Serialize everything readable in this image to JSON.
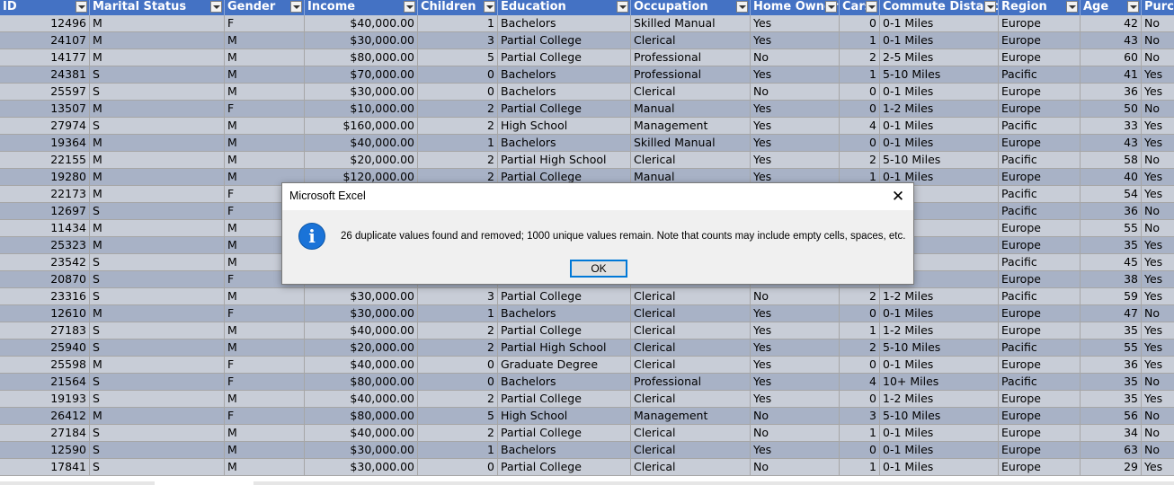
{
  "spreadsheet": {
    "headers": [
      "ID",
      "Marital Status",
      "Gender",
      "Income",
      "Children",
      "Education",
      "Occupation",
      "Home Owner",
      "Cars",
      "Commute Distance",
      "Region",
      "Age",
      "Purchased Bike"
    ],
    "rows": [
      [
        "12496",
        "M",
        "F",
        "$40,000.00",
        "1",
        "Bachelors",
        "Skilled Manual",
        "Yes",
        "0",
        "0-1 Miles",
        "Europe",
        "42",
        "No"
      ],
      [
        "24107",
        "M",
        "M",
        "$30,000.00",
        "3",
        "Partial College",
        "Clerical",
        "Yes",
        "1",
        "0-1 Miles",
        "Europe",
        "43",
        "No"
      ],
      [
        "14177",
        "M",
        "M",
        "$80,000.00",
        "5",
        "Partial College",
        "Professional",
        "No",
        "2",
        "2-5 Miles",
        "Europe",
        "60",
        "No"
      ],
      [
        "24381",
        "S",
        "M",
        "$70,000.00",
        "0",
        "Bachelors",
        "Professional",
        "Yes",
        "1",
        "5-10 Miles",
        "Pacific",
        "41",
        "Yes"
      ],
      [
        "25597",
        "S",
        "M",
        "$30,000.00",
        "0",
        "Bachelors",
        "Clerical",
        "No",
        "0",
        "0-1 Miles",
        "Europe",
        "36",
        "Yes"
      ],
      [
        "13507",
        "M",
        "F",
        "$10,000.00",
        "2",
        "Partial College",
        "Manual",
        "Yes",
        "0",
        "1-2 Miles",
        "Europe",
        "50",
        "No"
      ],
      [
        "27974",
        "S",
        "M",
        "$160,000.00",
        "2",
        "High School",
        "Management",
        "Yes",
        "4",
        "0-1 Miles",
        "Pacific",
        "33",
        "Yes"
      ],
      [
        "19364",
        "M",
        "M",
        "$40,000.00",
        "1",
        "Bachelors",
        "Skilled Manual",
        "Yes",
        "0",
        "0-1 Miles",
        "Europe",
        "43",
        "Yes"
      ],
      [
        "22155",
        "M",
        "M",
        "$20,000.00",
        "2",
        "Partial High School",
        "Clerical",
        "Yes",
        "2",
        "5-10 Miles",
        "Pacific",
        "58",
        "No"
      ],
      [
        "19280",
        "M",
        "M",
        "$120,000.00",
        "2",
        "Partial College",
        "Manual",
        "Yes",
        "1",
        "0-1 Miles",
        "Europe",
        "40",
        "Yes"
      ],
      [
        "22173",
        "M",
        "F",
        "",
        "",
        "",
        "",
        "",
        "",
        "",
        "Pacific",
        "54",
        "Yes"
      ],
      [
        "12697",
        "S",
        "F",
        "",
        "",
        "",
        "",
        "",
        "",
        "iles",
        "Pacific",
        "36",
        "No"
      ],
      [
        "11434",
        "M",
        "M",
        "",
        "",
        "",
        "",
        "",
        "",
        "les",
        "Europe",
        "55",
        "No"
      ],
      [
        "25323",
        "M",
        "M",
        "",
        "",
        "",
        "",
        "",
        "",
        "les",
        "Europe",
        "35",
        "Yes"
      ],
      [
        "23542",
        "S",
        "M",
        "",
        "",
        "",
        "",
        "",
        "",
        "les",
        "Pacific",
        "45",
        "Yes"
      ],
      [
        "20870",
        "S",
        "F",
        "",
        "",
        "",
        "",
        "",
        "",
        "les",
        "Europe",
        "38",
        "Yes"
      ],
      [
        "23316",
        "S",
        "M",
        "$30,000.00",
        "3",
        "Partial College",
        "Clerical",
        "No",
        "2",
        "1-2 Miles",
        "Pacific",
        "59",
        "Yes"
      ],
      [
        "12610",
        "M",
        "F",
        "$30,000.00",
        "1",
        "Bachelors",
        "Clerical",
        "Yes",
        "0",
        "0-1 Miles",
        "Europe",
        "47",
        "No"
      ],
      [
        "27183",
        "S",
        "M",
        "$40,000.00",
        "2",
        "Partial College",
        "Clerical",
        "Yes",
        "1",
        "1-2 Miles",
        "Europe",
        "35",
        "Yes"
      ],
      [
        "25940",
        "S",
        "M",
        "$20,000.00",
        "2",
        "Partial High School",
        "Clerical",
        "Yes",
        "2",
        "5-10 Miles",
        "Pacific",
        "55",
        "Yes"
      ],
      [
        "25598",
        "M",
        "F",
        "$40,000.00",
        "0",
        "Graduate Degree",
        "Clerical",
        "Yes",
        "0",
        "0-1 Miles",
        "Europe",
        "36",
        "Yes"
      ],
      [
        "21564",
        "S",
        "F",
        "$80,000.00",
        "0",
        "Bachelors",
        "Professional",
        "Yes",
        "4",
        "10+ Miles",
        "Pacific",
        "35",
        "No"
      ],
      [
        "19193",
        "S",
        "M",
        "$40,000.00",
        "2",
        "Partial College",
        "Clerical",
        "Yes",
        "0",
        "1-2 Miles",
        "Europe",
        "35",
        "Yes"
      ],
      [
        "26412",
        "M",
        "F",
        "$80,000.00",
        "5",
        "High School",
        "Management",
        "No",
        "3",
        "5-10 Miles",
        "Europe",
        "56",
        "No"
      ],
      [
        "27184",
        "S",
        "M",
        "$40,000.00",
        "2",
        "Partial College",
        "Clerical",
        "No",
        "1",
        "0-1 Miles",
        "Europe",
        "34",
        "No"
      ],
      [
        "12590",
        "S",
        "M",
        "$30,000.00",
        "1",
        "Bachelors",
        "Clerical",
        "Yes",
        "0",
        "0-1 Miles",
        "Europe",
        "63",
        "No"
      ],
      [
        "17841",
        "S",
        "M",
        "$30,000.00",
        "0",
        "Partial College",
        "Clerical",
        "No",
        "1",
        "0-1 Miles",
        "Europe",
        "29",
        "Yes"
      ]
    ]
  },
  "dialog": {
    "title": "Microsoft Excel",
    "close_glyph": "✕",
    "icon": "info-icon",
    "icon_glyph": "i",
    "message": "26 duplicate values found and removed; 1000 unique values remain. Note that counts may include empty cells, spaces, etc.",
    "ok_label": "OK"
  },
  "colors": {
    "header_bg": "#4472c4",
    "band_light": "#c8cdd7",
    "band_dark": "#a8b2c6",
    "dialog_bg": "#f0f0f0",
    "info_blue": "#1a73d8"
  }
}
